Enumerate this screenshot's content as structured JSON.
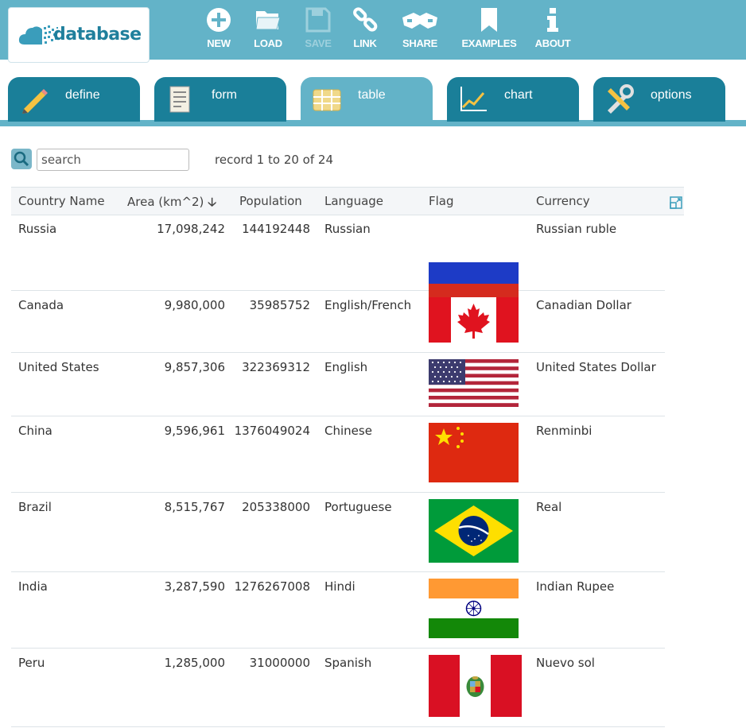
{
  "app": {
    "logo_text": "database"
  },
  "toolbar": {
    "new": "NEW",
    "load": "LOAD",
    "save": "SAVE",
    "link": "LINK",
    "share": "SHARE",
    "examples": "EXAMPLES",
    "about": "ABOUT"
  },
  "tabs": [
    {
      "label": "define",
      "active": false,
      "icon": "pencil-icon"
    },
    {
      "label": "form",
      "active": false,
      "icon": "document-icon"
    },
    {
      "label": "table",
      "active": true,
      "icon": "table-icon"
    },
    {
      "label": "chart",
      "active": false,
      "icon": "chart-icon"
    },
    {
      "label": "options",
      "active": false,
      "icon": "tools-icon"
    }
  ],
  "search": {
    "placeholder": "search",
    "value": ""
  },
  "record_count": "record 1 to 20 of 24",
  "table": {
    "columns": [
      "Country Name",
      "Area (km^2)",
      "Population",
      "Language",
      "Flag",
      "Currency"
    ],
    "sort": {
      "column": "Area (km^2)",
      "direction": "descending"
    },
    "rows": [
      {
        "country": "Russia",
        "area": "17,098,242",
        "population": "144192448",
        "language": "Russian",
        "flag": "russia",
        "currency": "Russian ruble"
      },
      {
        "country": "Canada",
        "area": "9,980,000",
        "population": "35985752",
        "language": "English/French",
        "flag": "canada",
        "currency": "Canadian Dollar"
      },
      {
        "country": "United States",
        "area": "9,857,306",
        "population": "322369312",
        "language": "English",
        "flag": "usa",
        "currency": "United States Dollar"
      },
      {
        "country": "China",
        "area": "9,596,961",
        "population": "1376049024",
        "language": "Chinese",
        "flag": "china",
        "currency": "Renminbi"
      },
      {
        "country": "Brazil",
        "area": "8,515,767",
        "population": "205338000",
        "language": "Portuguese",
        "flag": "brazil",
        "currency": "Real"
      },
      {
        "country": "India",
        "area": "3,287,590",
        "population": "1276267008",
        "language": "Hindi",
        "flag": "india",
        "currency": "Indian Rupee"
      },
      {
        "country": "Peru",
        "area": "1,285,000",
        "population": "31000000",
        "language": "Spanish",
        "flag": "peru",
        "currency": "Nuevo sol"
      }
    ]
  },
  "colors": {
    "header_bg": "#63b3c8",
    "tab_bg": "#1a7f99",
    "tab_active_bg": "#63b3c8",
    "logo_text": "#1f7f9c"
  }
}
